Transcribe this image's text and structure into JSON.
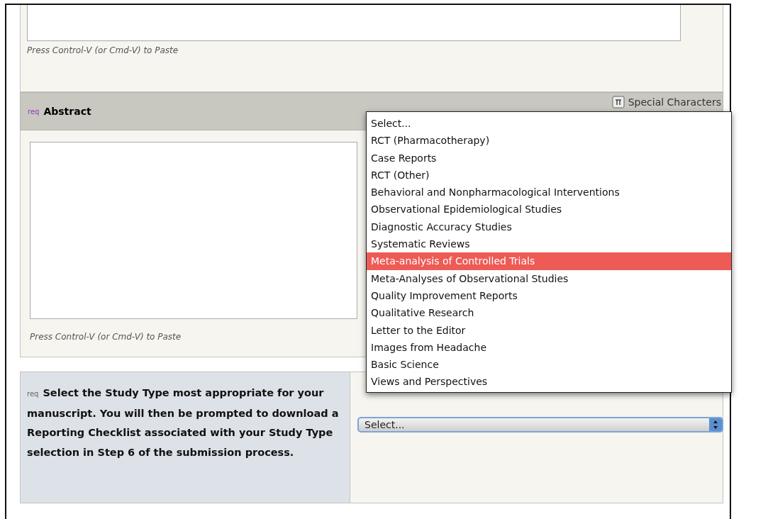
{
  "top_section": {
    "paste_hint": "Press Control-V (or Cmd-V) to Paste"
  },
  "abstract": {
    "required_mark": "req",
    "title": "Abstract",
    "special_characters": "Special Characters",
    "paste_hint": "Press Control-V (or Cmd-V) to Paste"
  },
  "study_type": {
    "required_mark": "req",
    "label": "Select the Study Type most appropriate for your manuscript. You will then be prompted to download a Reporting Checklist associated with your Study Type selection in Step 6 of the submission process.",
    "select": {
      "value": "Select...",
      "options": [
        {
          "label": "Select...",
          "highlighted": false
        },
        {
          "label": "RCT (Pharmacotherapy)",
          "highlighted": false
        },
        {
          "label": "Case Reports",
          "highlighted": false
        },
        {
          "label": "RCT (Other)",
          "highlighted": false
        },
        {
          "label": "Behavioral and Nonpharmacological Interventions",
          "highlighted": false
        },
        {
          "label": "Observational Epidemiological Studies",
          "highlighted": false
        },
        {
          "label": "Diagnostic Accuracy Studies",
          "highlighted": false
        },
        {
          "label": "Systematic Reviews",
          "highlighted": false
        },
        {
          "label": "Meta-analysis of Controlled Trials",
          "highlighted": true
        },
        {
          "label": "Meta-Analyses of Observational Studies",
          "highlighted": false
        },
        {
          "label": "Quality Improvement Reports",
          "highlighted": false
        },
        {
          "label": "Qualitative Research",
          "highlighted": false
        },
        {
          "label": "Letter to the Editor",
          "highlighted": false
        },
        {
          "label": "Images from Headache",
          "highlighted": false
        },
        {
          "label": "Basic Science",
          "highlighted": false
        },
        {
          "label": "Views and Perspectives",
          "highlighted": false
        }
      ]
    }
  }
}
